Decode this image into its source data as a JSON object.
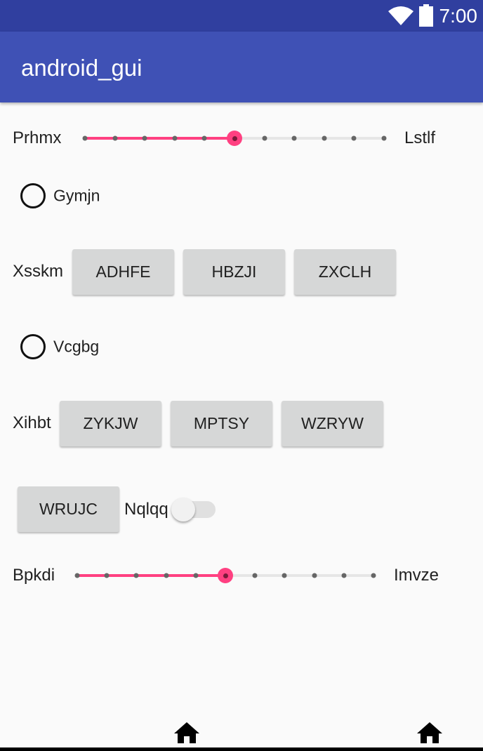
{
  "status_bar": {
    "time": "7:00",
    "icons": [
      "wifi-icon",
      "battery-icon"
    ]
  },
  "app_bar": {
    "title": "android_gui"
  },
  "slider1": {
    "left_label": "Prhmx",
    "right_label": "Lstlf",
    "min": 0,
    "max": 10,
    "value": 5
  },
  "radio1": {
    "label": "Gymjn",
    "checked": false
  },
  "row1": {
    "label": "Xsskm",
    "buttons": [
      "ADHFE",
      "HBZJI",
      "ZXCLH"
    ]
  },
  "radio2": {
    "label": "Vcgbg",
    "checked": false
  },
  "row2": {
    "label": "Xihbt",
    "buttons": [
      "ZYKJW",
      "MPTSY",
      "WZRYW"
    ]
  },
  "row3": {
    "button": "WRUJC",
    "switch_label": "Nqlqq",
    "switch_on": false
  },
  "slider2": {
    "left_label": "Bpkdi",
    "right_label": "Imvze",
    "min": 0,
    "max": 10,
    "value": 5
  },
  "colors": {
    "primary": "#3f51b5",
    "primary_dark": "#303f9f",
    "accent": "#ff4081"
  }
}
